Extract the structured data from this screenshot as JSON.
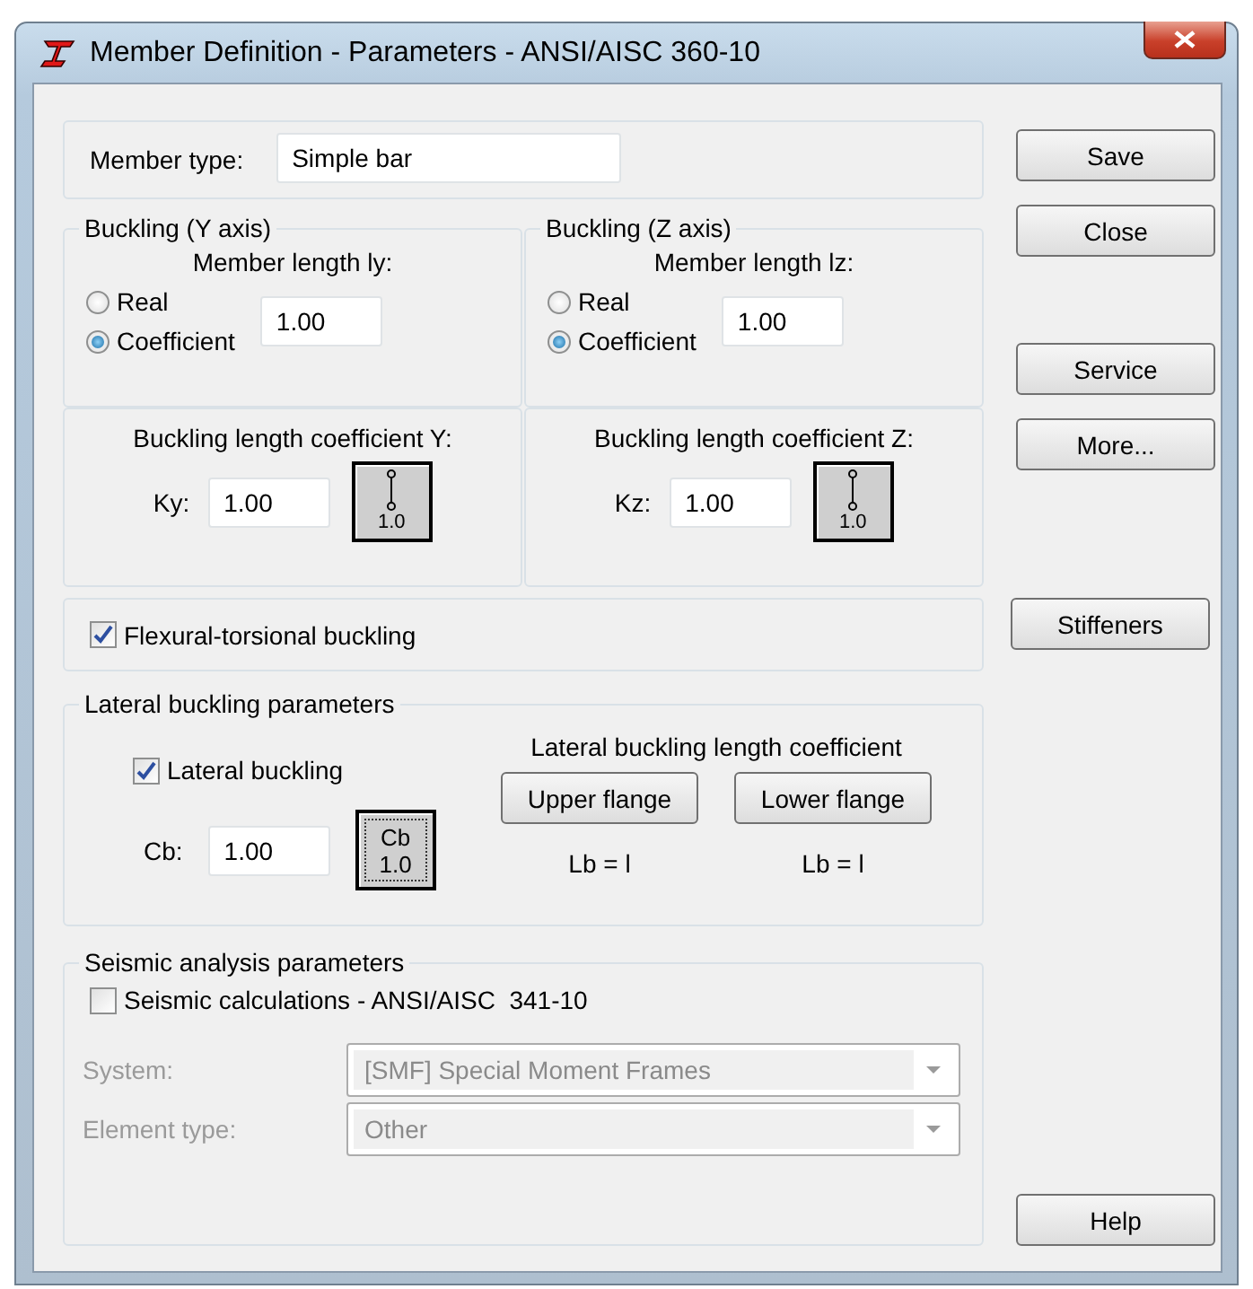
{
  "window": {
    "title": "Member Definition - Parameters - ANSI/AISC 360-10"
  },
  "member_type": {
    "label": "Member type:",
    "value": "Simple bar"
  },
  "buckling": [
    {
      "title": "Buckling (Y axis)",
      "length_label": "Member length ly:",
      "options": [
        {
          "label": "Real",
          "selected": false
        },
        {
          "label": "Coefficient",
          "selected": true
        }
      ],
      "length_value": "1.00",
      "coef_title": "Buckling length coefficient Y:",
      "k_label": "Ky:",
      "k_value": "1.00",
      "k_button": "1.0"
    },
    {
      "title": "Buckling (Z axis)",
      "length_label": "Member length lz:",
      "options": [
        {
          "label": "Real",
          "selected": false
        },
        {
          "label": "Coefficient",
          "selected": true
        }
      ],
      "length_value": "1.00",
      "coef_title": "Buckling length coefficient Z:",
      "k_label": "Kz:",
      "k_value": "1.00",
      "k_button": "1.0"
    }
  ],
  "flexural": {
    "label": "Flexural-torsional buckling",
    "checked": true
  },
  "lateral": {
    "title": "Lateral buckling parameters",
    "checkbox": {
      "label": "Lateral buckling",
      "checked": true
    },
    "cb_label": "Cb:",
    "cb_value": "1.00",
    "cb_button": [
      "Cb",
      "1.0"
    ],
    "coef_title": "Lateral buckling length coefficient",
    "flanges": [
      {
        "button": "Upper flange",
        "result": "Lb = l"
      },
      {
        "button": "Lower flange",
        "result": "Lb = l"
      }
    ]
  },
  "seismic": {
    "title": "Seismic analysis parameters",
    "checkbox": {
      "label": "Seismic calculations - ANSI/AISC  341-10",
      "checked": false
    },
    "fields": [
      {
        "label": "System:",
        "value": "[SMF] Special Moment Frames",
        "disabled": true
      },
      {
        "label": "Element type:",
        "value": "Other",
        "disabled": true
      }
    ]
  },
  "button_groups": [
    [
      "Save",
      "Close"
    ],
    [
      "Service",
      "More..."
    ],
    [
      "Stiffeners"
    ],
    [
      "Help"
    ]
  ]
}
